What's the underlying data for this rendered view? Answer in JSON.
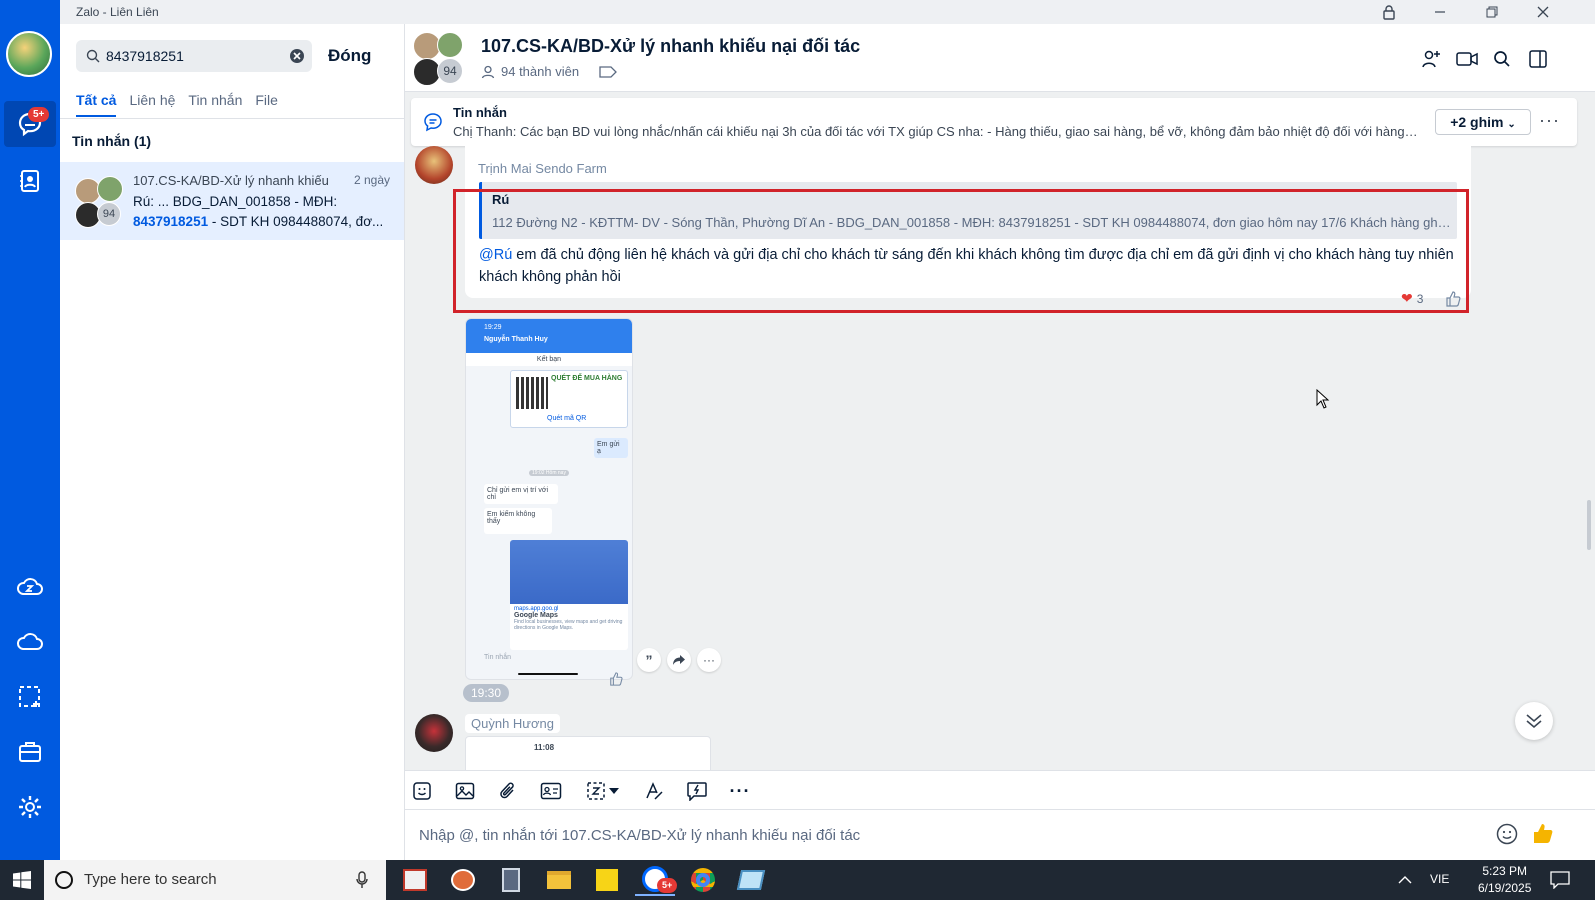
{
  "window": {
    "title": "Zalo - Liên Liên"
  },
  "nav": {
    "badge": "5+"
  },
  "search": {
    "value": "8437918251",
    "close_label": "Đóng"
  },
  "filter_tabs": [
    "Tất cả",
    "Liên hệ",
    "Tin nhắn",
    "File"
  ],
  "results": {
    "section_title": "Tin nhắn (1)",
    "item": {
      "name": "107.CS-KA/BD-Xử lý nhanh khiếu ...",
      "time": "2 ngày",
      "member_count": "94",
      "line1": "Rú: ... BDG_DAN_001858 - MĐH:",
      "line2_highlight": "8437918251",
      "line2_rest": " - SDT KH 0984488074, đơ..."
    }
  },
  "chat": {
    "title": "107.CS-KA/BD-Xử lý nhanh khiếu nại đối tác",
    "avatar_count": "94",
    "members": "94 thành viên",
    "pinned": {
      "label": "Tin nhắn",
      "text": "Chị Thanh: Các bạn BD vui lòng nhắc/nhấn cái khiếu nại 3h của đối tác với TX giúp CS nha: - Hàng thiếu, giao sai hàng, bể vỡ, không đảm bảo nhiệt độ đối với hàng đô...",
      "more": "+2 ghim"
    },
    "message1": {
      "sender": "Trịnh Mai Sendo Farm",
      "quote_name": "Rú",
      "quote_text": "112 Đường N2 - KĐTTM- DV - Sóng Thần, Phường Dĩ An - BDG_DAN_001858 - MĐH: 8437918251 - SDT KH 0984488074, đơn giao hôm nay 17/6 Khách hàng ghé điểm n...",
      "mention": "@Rú",
      "text": " em đã chủ động liên hệ khách và gửi địa chỉ cho khách từ sáng đến khi khách không tìm được địa chỉ em đã gửi định vị cho khách hàng tuy nhiên khách không phản hồi",
      "reaction_count": "3"
    },
    "image_message": {
      "time": "19:30",
      "phone": {
        "status_time": "19:29",
        "contact": "Nguyễn Thanh Huy",
        "friends": "Kết bạn",
        "qr_title": "QUÉT ĐỂ MUA HÀNG",
        "qr_link": "Quét mã QR",
        "sent": "Em gửi ạ",
        "date_pill": "19:02 Hôm nay",
        "msg_a": "Chỉ gửi em vị trí với chỉ",
        "msg_b": "Em kiếm không thấy",
        "map_url": "maps.app.goo.gl",
        "map_title": "Google Maps",
        "map_desc": "Find local businesses, view maps and get driving directions in Google Maps.",
        "input_placeholder": "Tin nhắn"
      }
    },
    "message2": {
      "sender": "Quỳnh Hương",
      "status_time": "11:08"
    }
  },
  "composer": {
    "placeholder": "Nhập @, tin nhắn tới 107.CS-KA/BD-Xử lý nhanh khiếu nại đối tác"
  },
  "taskbar": {
    "search_placeholder": "Type here to search",
    "lang": "VIE",
    "time": "5:23 PM",
    "date": "6/19/2025",
    "zalo_badge": "5+"
  },
  "colors": {
    "accent": "#005ae0",
    "highlight_box": "#d1232a",
    "nav_bg": "#005ae0"
  }
}
